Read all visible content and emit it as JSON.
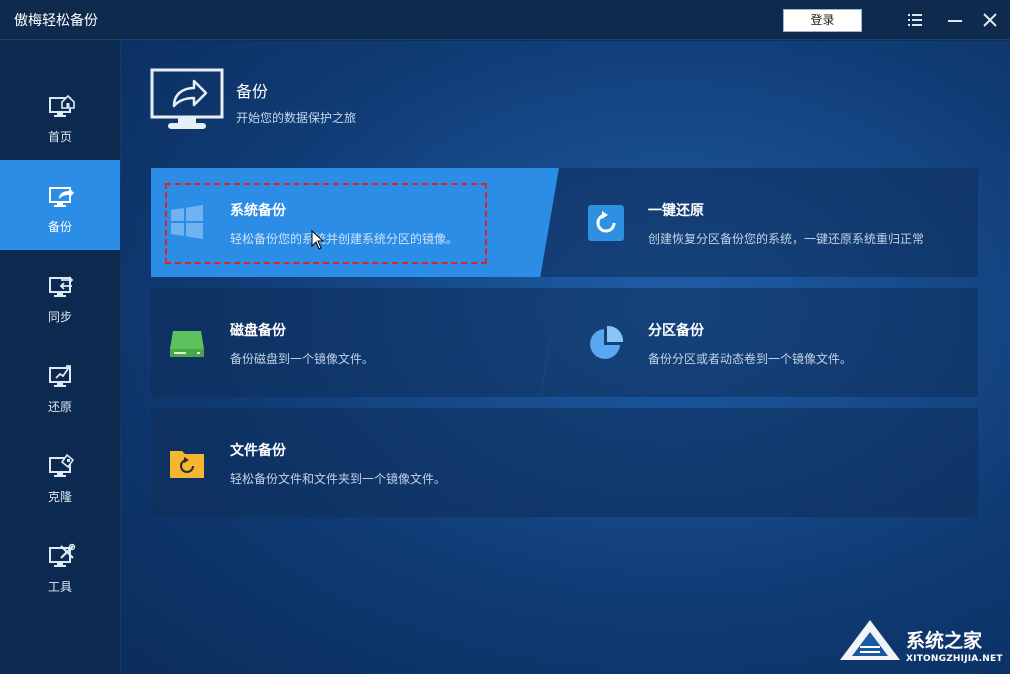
{
  "app": {
    "title": "傲梅轻松备份",
    "login_label": "登录"
  },
  "sidebar": {
    "items": [
      {
        "label": "首页",
        "icon": "home-monitor-icon",
        "active": false
      },
      {
        "label": "备份",
        "icon": "backup-monitor-icon",
        "active": true
      },
      {
        "label": "同步",
        "icon": "sync-monitor-icon",
        "active": false
      },
      {
        "label": "还原",
        "icon": "restore-monitor-icon",
        "active": false
      },
      {
        "label": "克隆",
        "icon": "clone-monitor-icon",
        "active": false
      },
      {
        "label": "工具",
        "icon": "tools-monitor-icon",
        "active": false
      }
    ]
  },
  "header": {
    "title": "备份",
    "subtitle": "开始您的数据保护之旅"
  },
  "cards": {
    "system_backup": {
      "title": "系统备份",
      "desc": "轻松备份您的系统并创建系统分区的镜像。"
    },
    "one_key_restore": {
      "title": "一键还原",
      "desc": "创建恢复分区备份您的系统，一键还原系统重归正常"
    },
    "disk_backup": {
      "title": "磁盘备份",
      "desc": "备份磁盘到一个镜像文件。"
    },
    "partition_backup": {
      "title": "分区备份",
      "desc": "备份分区或者动态卷到一个镜像文件。"
    },
    "file_backup": {
      "title": "文件备份",
      "desc": "轻松备份文件和文件夹到一个镜像文件。"
    }
  },
  "watermark": {
    "text": "系统之家",
    "url": "XITONGZHIJIA.NET"
  },
  "colors": {
    "accent": "#2b8de6",
    "highlight_border": "#e0202a",
    "disk_green": "#5cc25c",
    "folder_yellow": "#f5b731"
  }
}
